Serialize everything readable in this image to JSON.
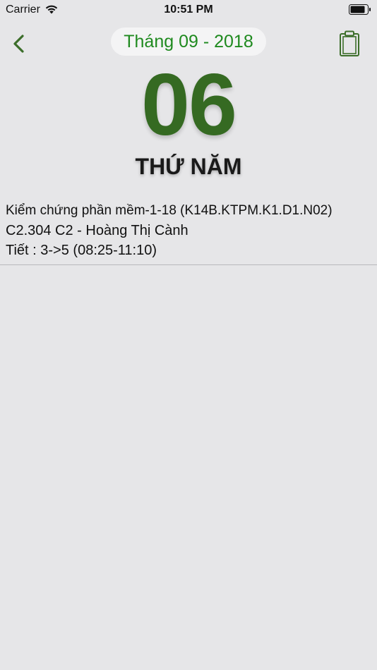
{
  "status_bar": {
    "carrier": "Carrier",
    "time": "10:51 PM",
    "wifi_icon": "wifi-icon",
    "battery_icon": "battery-icon"
  },
  "nav": {
    "back_icon": "chevron-left-icon",
    "month_label": "Tháng 09 - 2018",
    "clipboard_icon": "clipboard-icon"
  },
  "date": {
    "day": "06",
    "weekday": "THỨ NĂM"
  },
  "schedule": [
    {
      "course": "Kiểm chứng phần mềm-1-18 (K14B.KTPM.K1.D1.N02)",
      "room": "C2.304 C2 - Hoàng Thị Cành",
      "period": "Tiết : 3->5 (08:25-11:10)"
    }
  ],
  "colors": {
    "accent_green": "#1f8a1f",
    "day_green": "#356a22",
    "background": "#e6e6e8"
  }
}
